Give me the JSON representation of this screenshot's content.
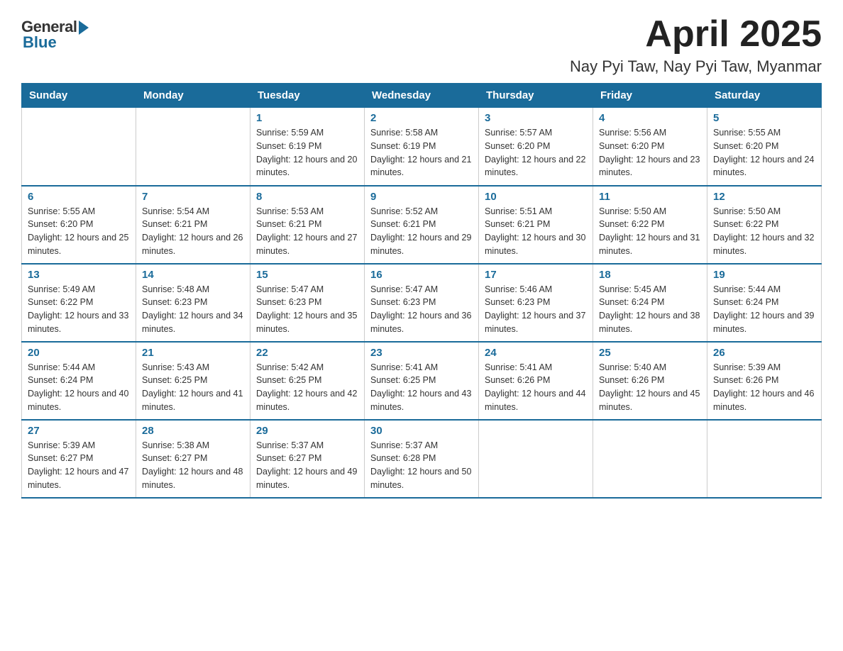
{
  "header": {
    "logo_general": "General",
    "logo_blue": "Blue",
    "title": "April 2025",
    "subtitle": "Nay Pyi Taw, Nay Pyi Taw, Myanmar"
  },
  "weekdays": [
    "Sunday",
    "Monday",
    "Tuesday",
    "Wednesday",
    "Thursday",
    "Friday",
    "Saturday"
  ],
  "weeks": [
    [
      {
        "day": "",
        "sunrise": "",
        "sunset": "",
        "daylight": ""
      },
      {
        "day": "",
        "sunrise": "",
        "sunset": "",
        "daylight": ""
      },
      {
        "day": "1",
        "sunrise": "Sunrise: 5:59 AM",
        "sunset": "Sunset: 6:19 PM",
        "daylight": "Daylight: 12 hours and 20 minutes."
      },
      {
        "day": "2",
        "sunrise": "Sunrise: 5:58 AM",
        "sunset": "Sunset: 6:19 PM",
        "daylight": "Daylight: 12 hours and 21 minutes."
      },
      {
        "day": "3",
        "sunrise": "Sunrise: 5:57 AM",
        "sunset": "Sunset: 6:20 PM",
        "daylight": "Daylight: 12 hours and 22 minutes."
      },
      {
        "day": "4",
        "sunrise": "Sunrise: 5:56 AM",
        "sunset": "Sunset: 6:20 PM",
        "daylight": "Daylight: 12 hours and 23 minutes."
      },
      {
        "day": "5",
        "sunrise": "Sunrise: 5:55 AM",
        "sunset": "Sunset: 6:20 PM",
        "daylight": "Daylight: 12 hours and 24 minutes."
      }
    ],
    [
      {
        "day": "6",
        "sunrise": "Sunrise: 5:55 AM",
        "sunset": "Sunset: 6:20 PM",
        "daylight": "Daylight: 12 hours and 25 minutes."
      },
      {
        "day": "7",
        "sunrise": "Sunrise: 5:54 AM",
        "sunset": "Sunset: 6:21 PM",
        "daylight": "Daylight: 12 hours and 26 minutes."
      },
      {
        "day": "8",
        "sunrise": "Sunrise: 5:53 AM",
        "sunset": "Sunset: 6:21 PM",
        "daylight": "Daylight: 12 hours and 27 minutes."
      },
      {
        "day": "9",
        "sunrise": "Sunrise: 5:52 AM",
        "sunset": "Sunset: 6:21 PM",
        "daylight": "Daylight: 12 hours and 29 minutes."
      },
      {
        "day": "10",
        "sunrise": "Sunrise: 5:51 AM",
        "sunset": "Sunset: 6:21 PM",
        "daylight": "Daylight: 12 hours and 30 minutes."
      },
      {
        "day": "11",
        "sunrise": "Sunrise: 5:50 AM",
        "sunset": "Sunset: 6:22 PM",
        "daylight": "Daylight: 12 hours and 31 minutes."
      },
      {
        "day": "12",
        "sunrise": "Sunrise: 5:50 AM",
        "sunset": "Sunset: 6:22 PM",
        "daylight": "Daylight: 12 hours and 32 minutes."
      }
    ],
    [
      {
        "day": "13",
        "sunrise": "Sunrise: 5:49 AM",
        "sunset": "Sunset: 6:22 PM",
        "daylight": "Daylight: 12 hours and 33 minutes."
      },
      {
        "day": "14",
        "sunrise": "Sunrise: 5:48 AM",
        "sunset": "Sunset: 6:23 PM",
        "daylight": "Daylight: 12 hours and 34 minutes."
      },
      {
        "day": "15",
        "sunrise": "Sunrise: 5:47 AM",
        "sunset": "Sunset: 6:23 PM",
        "daylight": "Daylight: 12 hours and 35 minutes."
      },
      {
        "day": "16",
        "sunrise": "Sunrise: 5:47 AM",
        "sunset": "Sunset: 6:23 PM",
        "daylight": "Daylight: 12 hours and 36 minutes."
      },
      {
        "day": "17",
        "sunrise": "Sunrise: 5:46 AM",
        "sunset": "Sunset: 6:23 PM",
        "daylight": "Daylight: 12 hours and 37 minutes."
      },
      {
        "day": "18",
        "sunrise": "Sunrise: 5:45 AM",
        "sunset": "Sunset: 6:24 PM",
        "daylight": "Daylight: 12 hours and 38 minutes."
      },
      {
        "day": "19",
        "sunrise": "Sunrise: 5:44 AM",
        "sunset": "Sunset: 6:24 PM",
        "daylight": "Daylight: 12 hours and 39 minutes."
      }
    ],
    [
      {
        "day": "20",
        "sunrise": "Sunrise: 5:44 AM",
        "sunset": "Sunset: 6:24 PM",
        "daylight": "Daylight: 12 hours and 40 minutes."
      },
      {
        "day": "21",
        "sunrise": "Sunrise: 5:43 AM",
        "sunset": "Sunset: 6:25 PM",
        "daylight": "Daylight: 12 hours and 41 minutes."
      },
      {
        "day": "22",
        "sunrise": "Sunrise: 5:42 AM",
        "sunset": "Sunset: 6:25 PM",
        "daylight": "Daylight: 12 hours and 42 minutes."
      },
      {
        "day": "23",
        "sunrise": "Sunrise: 5:41 AM",
        "sunset": "Sunset: 6:25 PM",
        "daylight": "Daylight: 12 hours and 43 minutes."
      },
      {
        "day": "24",
        "sunrise": "Sunrise: 5:41 AM",
        "sunset": "Sunset: 6:26 PM",
        "daylight": "Daylight: 12 hours and 44 minutes."
      },
      {
        "day": "25",
        "sunrise": "Sunrise: 5:40 AM",
        "sunset": "Sunset: 6:26 PM",
        "daylight": "Daylight: 12 hours and 45 minutes."
      },
      {
        "day": "26",
        "sunrise": "Sunrise: 5:39 AM",
        "sunset": "Sunset: 6:26 PM",
        "daylight": "Daylight: 12 hours and 46 minutes."
      }
    ],
    [
      {
        "day": "27",
        "sunrise": "Sunrise: 5:39 AM",
        "sunset": "Sunset: 6:27 PM",
        "daylight": "Daylight: 12 hours and 47 minutes."
      },
      {
        "day": "28",
        "sunrise": "Sunrise: 5:38 AM",
        "sunset": "Sunset: 6:27 PM",
        "daylight": "Daylight: 12 hours and 48 minutes."
      },
      {
        "day": "29",
        "sunrise": "Sunrise: 5:37 AM",
        "sunset": "Sunset: 6:27 PM",
        "daylight": "Daylight: 12 hours and 49 minutes."
      },
      {
        "day": "30",
        "sunrise": "Sunrise: 5:37 AM",
        "sunset": "Sunset: 6:28 PM",
        "daylight": "Daylight: 12 hours and 50 minutes."
      },
      {
        "day": "",
        "sunrise": "",
        "sunset": "",
        "daylight": ""
      },
      {
        "day": "",
        "sunrise": "",
        "sunset": "",
        "daylight": ""
      },
      {
        "day": "",
        "sunrise": "",
        "sunset": "",
        "daylight": ""
      }
    ]
  ]
}
